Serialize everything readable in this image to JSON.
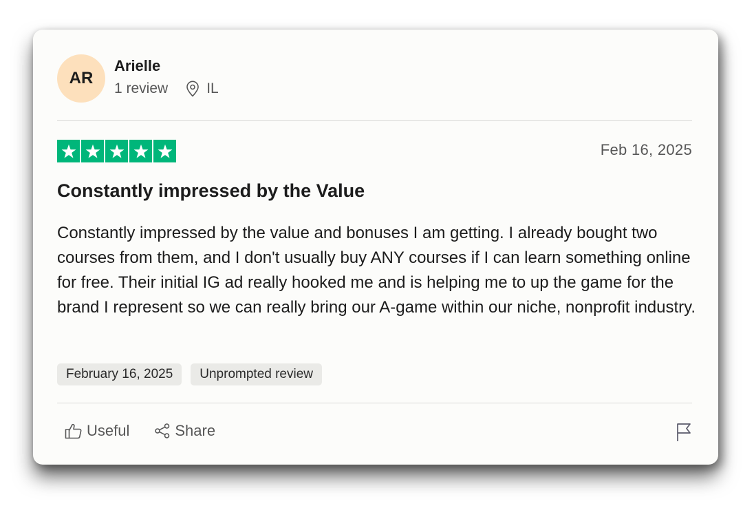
{
  "reviewer": {
    "initials": "AR",
    "name": "Arielle",
    "review_count": "1 review",
    "location": "IL",
    "avatar_color": "#fde0bc"
  },
  "rating": {
    "stars": 5,
    "max_stars": 5,
    "star_color": "#00b67a"
  },
  "review": {
    "date": "Feb 16, 2025",
    "title": "Constantly impressed by the Value",
    "body": "Constantly impressed by the value and bonuses I am getting. I already bought two courses from them, and I don't usually buy ANY courses if I can learn something online for free. Their initial IG ad really hooked me and is helping me to up the game for the brand I represent so we can really bring our A-game within our niche, nonprofit industry."
  },
  "tags": {
    "experience_date": "February 16, 2025",
    "review_type": "Unprompted review"
  },
  "actions": {
    "useful_label": "Useful",
    "share_label": "Share",
    "useful_icon": "thumbs-up-icon",
    "share_icon": "share-icon",
    "flag_icon": "flag-icon"
  }
}
